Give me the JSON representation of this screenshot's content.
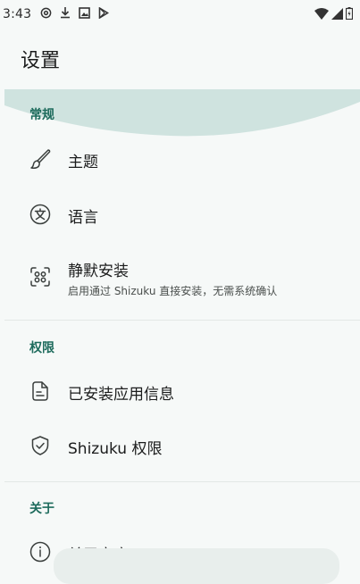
{
  "status_bar": {
    "time": "3:43",
    "notification_icons": [
      "at-icon",
      "download-icon",
      "image-icon",
      "play-store-icon"
    ],
    "system_icons": [
      "wifi-icon",
      "cell-signal-icon",
      "battery-icon"
    ]
  },
  "page": {
    "title": "设置"
  },
  "sections": [
    {
      "label": "常规",
      "items": [
        {
          "label": "主题",
          "icon": "brush-icon"
        },
        {
          "label": "语言",
          "icon": "translate-icon"
        },
        {
          "label": "静默安装",
          "subtitle": "启用通过 Shizuku 直接安装，无需系统确认",
          "icon": "face-scan-icon"
        }
      ]
    },
    {
      "label": "权限",
      "items": [
        {
          "label": "已安装应用信息",
          "icon": "document-icon"
        },
        {
          "label": "Shizuku 权限",
          "icon": "shield-check-icon"
        }
      ]
    },
    {
      "label": "关于",
      "items": [
        {
          "label": "关于商店",
          "icon": "info-icon"
        }
      ]
    }
  ],
  "colors": {
    "background": "#f6f9f8",
    "accent": "#1d6b5c",
    "wave": "#cfe3df",
    "text": "#1b1c1c"
  }
}
